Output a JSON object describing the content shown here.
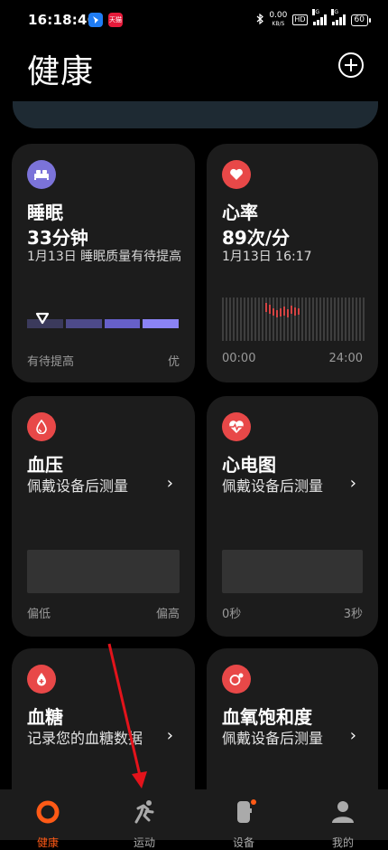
{
  "status": {
    "time": "16:18:46",
    "app2_label": "天猫",
    "speed_value": "0.00",
    "speed_unit": "KB/S",
    "hd": "HD",
    "sig1": "5G",
    "sig2": "5G",
    "battery": "60"
  },
  "header": {
    "title": "健康"
  },
  "cards": {
    "sleep": {
      "title": "睡眠",
      "value": "33分钟",
      "sub": "1月13日 睡眠质量有待提高",
      "foot_left": "有待提高",
      "foot_right": "优",
      "colors": [
        "#3b3a5c",
        "#4d4a8a",
        "#6660c9",
        "#8b83f5"
      ],
      "level": 0.1
    },
    "heart": {
      "title": "心率",
      "value": "89次/分",
      "sub": "1月13日 16:17",
      "foot_left": "00:00",
      "foot_right": "24:00"
    },
    "bp": {
      "title": "血压",
      "sub": "佩戴设备后测量",
      "foot_left": "偏低",
      "foot_right": "偏高"
    },
    "ecg": {
      "title": "心电图",
      "sub": "佩戴设备后测量",
      "foot_left": "0秒",
      "foot_right": "3秒"
    },
    "glucose": {
      "title": "血糖",
      "sub": "记录您的血糖数据"
    },
    "spo2": {
      "title": "血氧饱和度",
      "sub": "佩戴设备后测量"
    }
  },
  "nav": [
    {
      "label": "健康",
      "icon": "health-ring-icon",
      "active": true
    },
    {
      "label": "运动",
      "icon": "running-icon",
      "active": false
    },
    {
      "label": "设备",
      "icon": "watch-icon",
      "active": false
    },
    {
      "label": "我的",
      "icon": "person-icon",
      "active": false
    }
  ],
  "accent": "#ff5a16"
}
